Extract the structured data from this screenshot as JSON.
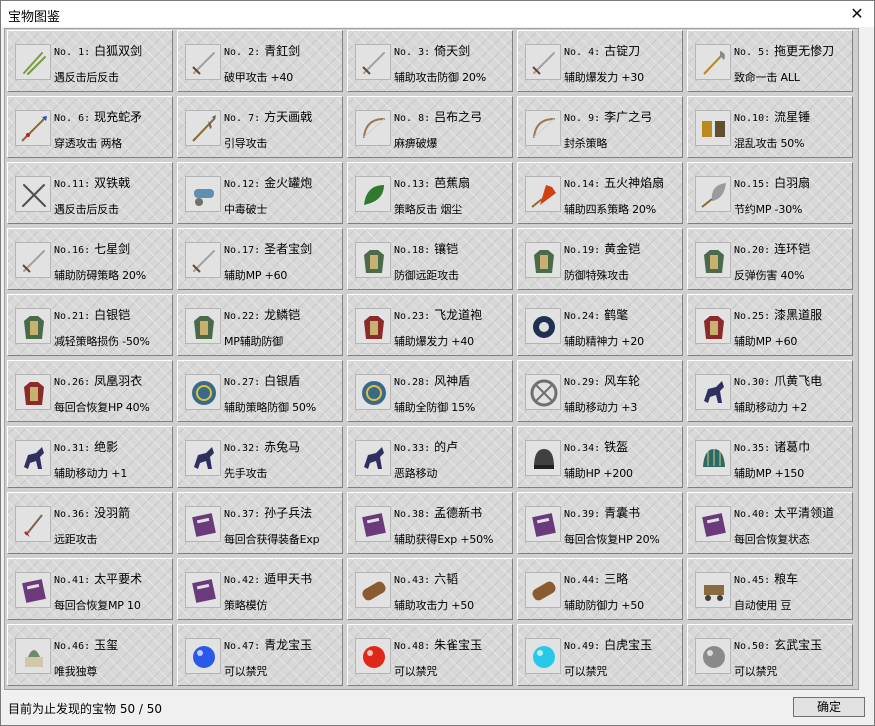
{
  "window": {
    "title": "宝物图鉴",
    "close_glyph": "✕"
  },
  "items": [
    {
      "no": "No. 1:",
      "name": "白狐双剑",
      "effect": "遇反击后反击",
      "icon": "twin-swords-icon"
    },
    {
      "no": "No. 2:",
      "name": "青釭剑",
      "effect": "破甲攻击 +40",
      "icon": "sword-icon"
    },
    {
      "no": "No. 3:",
      "name": "倚天剑",
      "effect": "辅助攻击防御 20%",
      "icon": "sword-icon"
    },
    {
      "no": "No. 4:",
      "name": "古锭刀",
      "effect": "辅助爆发力 +30",
      "icon": "sword-icon"
    },
    {
      "no": "No. 5:",
      "name": "拖更无惨刀",
      "effect": "致命一击 ALL",
      "icon": "glaive-icon"
    },
    {
      "no": "No. 6:",
      "name": "现充蛇矛",
      "effect": "穿透攻击 两格",
      "icon": "spear-icon"
    },
    {
      "no": "No. 7:",
      "name": "方天画戟",
      "effect": "引导攻击",
      "icon": "halberd-icon"
    },
    {
      "no": "No. 8:",
      "name": "吕布之弓",
      "effect": "麻痹破爆",
      "icon": "bow-icon"
    },
    {
      "no": "No. 9:",
      "name": "李广之弓",
      "effect": "封杀策略",
      "icon": "bow-icon"
    },
    {
      "no": "No.10:",
      "name": "流星锤",
      "effect": "混乱攻击 50%",
      "icon": "flail-icon"
    },
    {
      "no": "No.11:",
      "name": "双铁戟",
      "effect": "遇反击后反击",
      "icon": "crossed-axes-icon"
    },
    {
      "no": "No.12:",
      "name": "金火罐炮",
      "effect": "中毒破士",
      "icon": "cannon-icon"
    },
    {
      "no": "No.13:",
      "name": "芭蕉扇",
      "effect": "策略反击 烟尘",
      "icon": "leaf-fan-icon"
    },
    {
      "no": "No.14:",
      "name": "五火神焰扇",
      "effect": "辅助四系策略 20%",
      "icon": "flame-fan-icon"
    },
    {
      "no": "No.15:",
      "name": "白羽扇",
      "effect": "节约MP -30%",
      "icon": "feather-fan-icon"
    },
    {
      "no": "No.16:",
      "name": "七星剑",
      "effect": "辅助防碍策略 20%",
      "icon": "sword-icon"
    },
    {
      "no": "No.17:",
      "name": "圣者宝剑",
      "effect": "辅助MP +60",
      "icon": "sword-icon"
    },
    {
      "no": "No.18:",
      "name": "镶铠",
      "effect": "防御远距攻击",
      "icon": "armor-icon"
    },
    {
      "no": "No.19:",
      "name": "黄金铠",
      "effect": "防御特殊攻击",
      "icon": "armor-icon"
    },
    {
      "no": "No.20:",
      "name": "连环铠",
      "effect": "反弹伤害 40%",
      "icon": "armor-icon"
    },
    {
      "no": "No.21:",
      "name": "白银铠",
      "effect": "减轻策略损伤 -50%",
      "icon": "armor-icon"
    },
    {
      "no": "No.22:",
      "name": "龙鳞铠",
      "effect": "MP辅助防御",
      "icon": "armor-icon"
    },
    {
      "no": "No.23:",
      "name": "飞龙道袍",
      "effect": "辅助爆发力 +40",
      "icon": "robe-icon"
    },
    {
      "no": "No.24:",
      "name": "鹤氅",
      "effect": "辅助精神力 +20",
      "icon": "cloak-icon"
    },
    {
      "no": "No.25:",
      "name": "漆黑道服",
      "effect": "辅助MP +60",
      "icon": "robe-icon"
    },
    {
      "no": "No.26:",
      "name": "凤凰羽衣",
      "effect": "每回合恢复HP 40%",
      "icon": "robe-icon"
    },
    {
      "no": "No.27:",
      "name": "白银盾",
      "effect": "辅助策略防御 50%",
      "icon": "shield-icon"
    },
    {
      "no": "No.28:",
      "name": "风神盾",
      "effect": "辅助全防御 15%",
      "icon": "shield-icon"
    },
    {
      "no": "No.29:",
      "name": "风车轮",
      "effect": "辅助移动力 +3",
      "icon": "wheel-icon"
    },
    {
      "no": "No.30:",
      "name": "爪黄飞电",
      "effect": "辅助移动力 +2",
      "icon": "horse-icon"
    },
    {
      "no": "No.31:",
      "name": "绝影",
      "effect": "辅助移动力 +1",
      "icon": "horse-icon"
    },
    {
      "no": "No.32:",
      "name": "赤兔马",
      "effect": "先手攻击",
      "icon": "horse-icon"
    },
    {
      "no": "No.33:",
      "name": "的卢",
      "effect": "恶路移动",
      "icon": "horse-icon"
    },
    {
      "no": "No.34:",
      "name": "铁盔",
      "effect": "辅助HP +200",
      "icon": "helmet-icon"
    },
    {
      "no": "No.35:",
      "name": "诸葛巾",
      "effect": "辅助MP +150",
      "icon": "hat-icon"
    },
    {
      "no": "No.36:",
      "name": "没羽箭",
      "effect": "远距攻击",
      "icon": "dart-icon"
    },
    {
      "no": "No.37:",
      "name": "孙子兵法",
      "effect": "每回合获得装备Exp",
      "icon": "book-icon"
    },
    {
      "no": "No.38:",
      "name": "孟德新书",
      "effect": "辅助获得Exp +50%",
      "icon": "book-icon"
    },
    {
      "no": "No.39:",
      "name": "青囊书",
      "effect": "每回合恢复HP 20%",
      "icon": "book-icon"
    },
    {
      "no": "No.40:",
      "name": "太平清领道",
      "effect": "每回合恢复状态",
      "icon": "book-icon"
    },
    {
      "no": "No.41:",
      "name": "太平要术",
      "effect": "每回合恢复MP 10",
      "icon": "book-icon"
    },
    {
      "no": "No.42:",
      "name": "遁甲天书",
      "effect": "策略模仿",
      "icon": "book-icon"
    },
    {
      "no": "No.43:",
      "name": "六韬",
      "effect": "辅助攻击力 +50",
      "icon": "scroll-icon"
    },
    {
      "no": "No.44:",
      "name": "三略",
      "effect": "辅助防御力 +50",
      "icon": "scroll-icon"
    },
    {
      "no": "No.45:",
      "name": "粮车",
      "effect": "自动使用 豆",
      "icon": "cart-icon"
    },
    {
      "no": "No.46:",
      "name": "玉玺",
      "effect": "唯我独尊",
      "icon": "seal-icon"
    },
    {
      "no": "No.47:",
      "name": "青龙宝玉",
      "effect": "可以禁咒",
      "icon": "orb-icon"
    },
    {
      "no": "No.48:",
      "name": "朱雀宝玉",
      "effect": "可以禁咒",
      "icon": "orb-icon"
    },
    {
      "no": "No.49:",
      "name": "白虎宝玉",
      "effect": "可以禁咒",
      "icon": "orb-icon"
    },
    {
      "no": "No.50:",
      "name": "玄武宝玉",
      "effect": "可以禁咒",
      "icon": "orb-icon"
    }
  ],
  "icon_colors": {
    "sword-icon": "#a0a0a8",
    "twin-swords-icon": "#7a9a40",
    "glaive-icon": "#8a8a8a",
    "spear-icon": "#2050c0",
    "halberd-icon": "#606060",
    "bow-icon": "#9a7a55",
    "flail-icon": "#b88a20",
    "crossed-axes-icon": "#505050",
    "cannon-icon": "#6090b0",
    "leaf-fan-icon": "#2f7a2f",
    "flame-fan-icon": "#d04010",
    "feather-fan-icon": "#9a9aa0",
    "armor-icon": "#4a6a4a",
    "robe-icon": "#8a2a2a",
    "cloak-icon": "#203050",
    "shield-icon": "#3a6a8a",
    "wheel-icon": "#707070",
    "horse-icon": "#303060",
    "helmet-icon": "#404040",
    "hat-icon": "#2a6a6a",
    "dart-icon": "#806050",
    "book-icon": "#6a3a7a",
    "scroll-icon": "#8a5a30",
    "cart-icon": "#8a6a40",
    "seal-icon": "#6a8a6a",
    "orb-icon": "#3060e0"
  },
  "orb_colors": [
    "#2a58e8",
    "#e02818",
    "#28c8e8",
    "#8a8a8a"
  ],
  "footer": {
    "status": "目前为止发现的宝物 50 / 50",
    "ok_label": "确定"
  }
}
